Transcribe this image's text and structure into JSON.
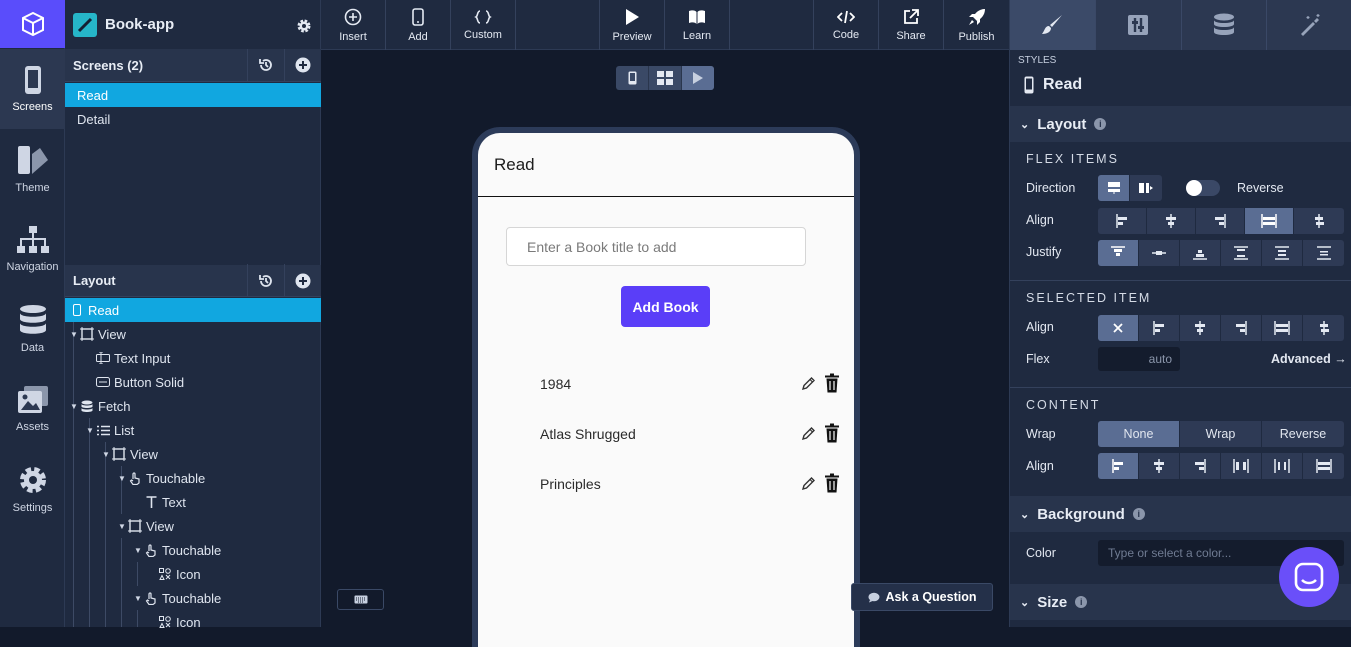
{
  "app": {
    "project_name": "Book-app"
  },
  "rail": [
    {
      "label": "Screens",
      "icon": "phone-icon"
    },
    {
      "label": "Theme",
      "icon": "theme-icon"
    },
    {
      "label": "Navigation",
      "icon": "navigation-icon"
    },
    {
      "label": "Data",
      "icon": "database-icon"
    },
    {
      "label": "Assets",
      "icon": "image-icon"
    },
    {
      "label": "Settings",
      "icon": "gear-icon"
    }
  ],
  "screens": {
    "title": "Screens (2)",
    "items": [
      "Read",
      "Detail"
    ],
    "selected": "Read"
  },
  "layout": {
    "title": "Layout",
    "tree": [
      {
        "label": "Read",
        "icon": "phone-icon"
      },
      {
        "label": "View",
        "icon": "view-icon"
      },
      {
        "label": "Text Input",
        "icon": "text-input-icon"
      },
      {
        "label": "Button Solid",
        "icon": "button-icon"
      },
      {
        "label": "Fetch",
        "icon": "database-icon"
      },
      {
        "label": "List",
        "icon": "list-icon"
      },
      {
        "label": "View",
        "icon": "view-icon"
      },
      {
        "label": "Touchable",
        "icon": "touch-icon"
      },
      {
        "label": "Text",
        "icon": "text-icon"
      },
      {
        "label": "View",
        "icon": "view-icon"
      },
      {
        "label": "Touchable",
        "icon": "touch-icon"
      },
      {
        "label": "Icon",
        "icon": "icon-icon"
      },
      {
        "label": "Touchable",
        "icon": "touch-icon"
      },
      {
        "label": "Icon",
        "icon": "icon-icon"
      }
    ]
  },
  "toolbar": {
    "insert": "Insert",
    "add": "Add",
    "custom": "Custom",
    "preview": "Preview",
    "learn": "Learn",
    "code": "Code",
    "share": "Share",
    "publish": "Publish"
  },
  "preview": {
    "screen_title": "Read",
    "input_placeholder": "Enter a Book title to add",
    "add_button": "Add Book",
    "books": [
      "1984",
      "Atlas Shrugged",
      "Principles"
    ]
  },
  "ask": "Ask a Question",
  "styles": {
    "caption": "STYLES",
    "screen": "Read",
    "layout_title": "Layout",
    "flex_items": "FLEX ITEMS",
    "direction_label": "Direction",
    "reverse_label": "Reverse",
    "reverse_on": false,
    "align_label": "Align",
    "justify_label": "Justify",
    "selected_item": "SELECTED ITEM",
    "sel_align_label": "Align",
    "flex_label": "Flex",
    "flex_value": "auto",
    "advanced": "Advanced →",
    "content": "CONTENT",
    "wrap_label": "Wrap",
    "wrap_options": [
      "None",
      "Wrap",
      "Reverse"
    ],
    "wrap_selected": "None",
    "content_align_label": "Align",
    "background_title": "Background",
    "color_label": "Color",
    "color_placeholder": "Type or select a color...",
    "size_title": "Size"
  },
  "colors": {
    "accent": "#5a4dfb",
    "selection": "#11a7e0",
    "button": "#5a3ef8"
  }
}
